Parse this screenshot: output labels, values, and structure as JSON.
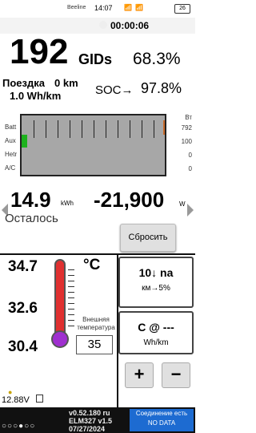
{
  "status_bar": {
    "carrier": "Beeline",
    "time": "14:07",
    "icons": "📶 📶 ",
    "battery": "26"
  },
  "timer": "00:00:06",
  "gids": {
    "value": "192",
    "unit": "GIDs",
    "soc_percent": "68.3%"
  },
  "trip": {
    "label": "Поездка",
    "distance": "0 km",
    "consumption": "1.0 Wh/km"
  },
  "soc": {
    "label": "SOC→",
    "value": "97.8%"
  },
  "gauge": {
    "rows": [
      "Batt",
      "Aux",
      "Hetr",
      "A/C"
    ],
    "right_header": "Вт",
    "values": [
      "792",
      "100",
      "0",
      "0"
    ],
    "aux_fill_fraction": 0.04,
    "colors": {
      "aux": "#1db21d",
      "bar_bg": "#a7a7a7"
    }
  },
  "energy": {
    "value": "14.9",
    "unit": "kWh"
  },
  "power": {
    "value": "-21,900",
    "unit": "W"
  },
  "remain_label": "Осталось",
  "reset_label": "Сбросить",
  "temps": {
    "t1": "34.7",
    "t2": "32.6",
    "t3": "30.4",
    "unit": "°C"
  },
  "external_temp": {
    "label": "Внешняя температура",
    "value": "35"
  },
  "right_panel": {
    "range_top": "10↓ na",
    "range_bottom": "км→5%",
    "eff_top": "C @ ---",
    "eff_bottom": "Wh/km"
  },
  "buttons": {
    "plus": "+",
    "minus": "−"
  },
  "voltage": "12.88V",
  "footer": {
    "dots": "○○○●○○",
    "version": "v0.52.180 ru",
    "elm": "ELM327 v1.5",
    "date": "07/27/2024",
    "status": "Соединение есть\nNO DATA"
  }
}
